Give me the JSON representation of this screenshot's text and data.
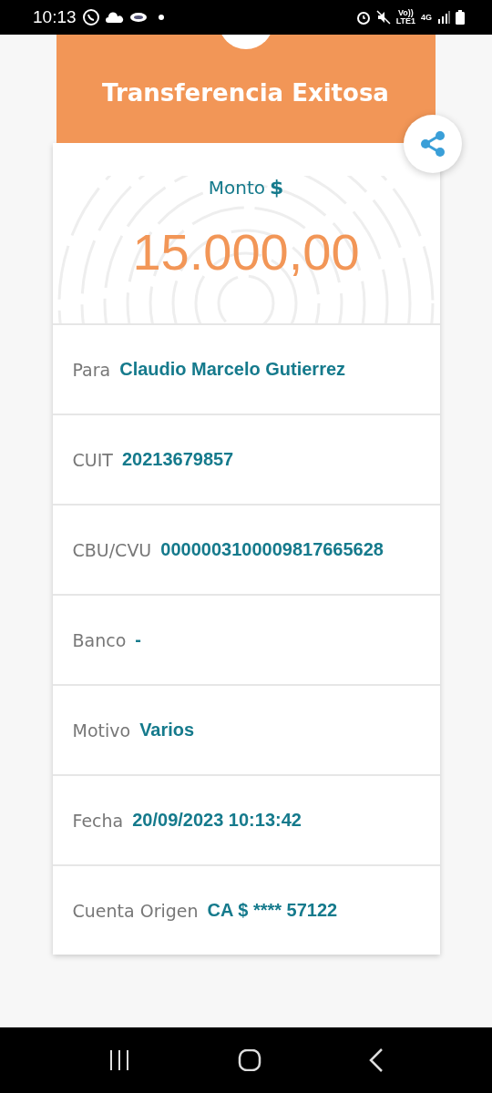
{
  "status_bar": {
    "time": "10:13",
    "volte": "Vo))",
    "lte": "LTE1",
    "network": "4G"
  },
  "header": {
    "title": "Transferencia Exitosa"
  },
  "amount": {
    "label": "Monto",
    "currency": "$",
    "value": "15.000,00"
  },
  "details": [
    {
      "label": "Para",
      "value": "Claudio Marcelo Gutierrez"
    },
    {
      "label": "CUIT",
      "value": "20213679857"
    },
    {
      "label": "CBU/CVU",
      "value": "0000003100009817665628"
    },
    {
      "label": "Banco",
      "value": "-"
    },
    {
      "label": "Motivo",
      "value": "Varios"
    },
    {
      "label": "Fecha",
      "value": "20/09/2023 10:13:42"
    },
    {
      "label": "Cuenta Origen",
      "value": "CA $ **** 57122"
    }
  ]
}
